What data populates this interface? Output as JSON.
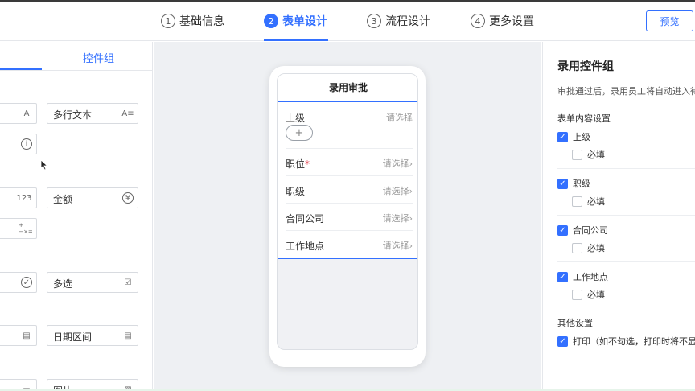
{
  "steps": [
    {
      "num": "1",
      "label": "基础信息"
    },
    {
      "num": "2",
      "label": "表单设计"
    },
    {
      "num": "3",
      "label": "流程设计"
    },
    {
      "num": "4",
      "label": "更多设置"
    }
  ],
  "preview_label": "预览",
  "left_panel": {
    "tab_group_label": "控件组",
    "controls": [
      {
        "label": "",
        "icon": "A"
      },
      {
        "label": "多行文本",
        "icon": "A≡"
      },
      {
        "label": "",
        "icon": "i"
      },
      {
        "label": "",
        "icon": "123"
      },
      {
        "label": "金额",
        "icon": "¥"
      },
      {
        "label": "",
        "icon": "+−×="
      },
      {
        "label": "",
        "icon": "✓"
      },
      {
        "label": "多选",
        "icon": "☑"
      },
      {
        "label": "",
        "icon": "▤"
      },
      {
        "label": "日期区间",
        "icon": "▤"
      },
      {
        "label": "",
        "icon": "▭"
      },
      {
        "label": "图片",
        "icon": "▨"
      }
    ]
  },
  "phone": {
    "title": "录用审批",
    "fields": [
      {
        "label": "上级",
        "value": "请选择",
        "required": false
      },
      {
        "label": "职位",
        "value": "请选择",
        "required": true
      },
      {
        "label": "职级",
        "value": "请选择",
        "required": false
      },
      {
        "label": "合同公司",
        "value": "请选择",
        "required": false
      },
      {
        "label": "工作地点",
        "value": "请选择",
        "required": false
      }
    ],
    "add_symbol": "+",
    "required_mark": "*"
  },
  "right_panel": {
    "title": "录用控件组",
    "description": "审批通过后，录用员工将自动进入待",
    "content_section": "表单内容设置",
    "items": [
      {
        "label": "上级",
        "checked": true,
        "required_label": "必填",
        "required_checked": false
      },
      {
        "label": "职级",
        "checked": true,
        "required_label": "必填",
        "required_checked": false
      },
      {
        "label": "合同公司",
        "checked": true,
        "required_label": "必填",
        "required_checked": false
      },
      {
        "label": "工作地点",
        "checked": true,
        "required_label": "必填",
        "required_checked": false
      }
    ],
    "other_section": "其他设置",
    "print_label": "打印（如不勾选，打印时将不显示",
    "print_checked": true
  },
  "colors": {
    "accent": "#3370ff",
    "canvas": "#eef0f3",
    "required": "#e34d59"
  }
}
